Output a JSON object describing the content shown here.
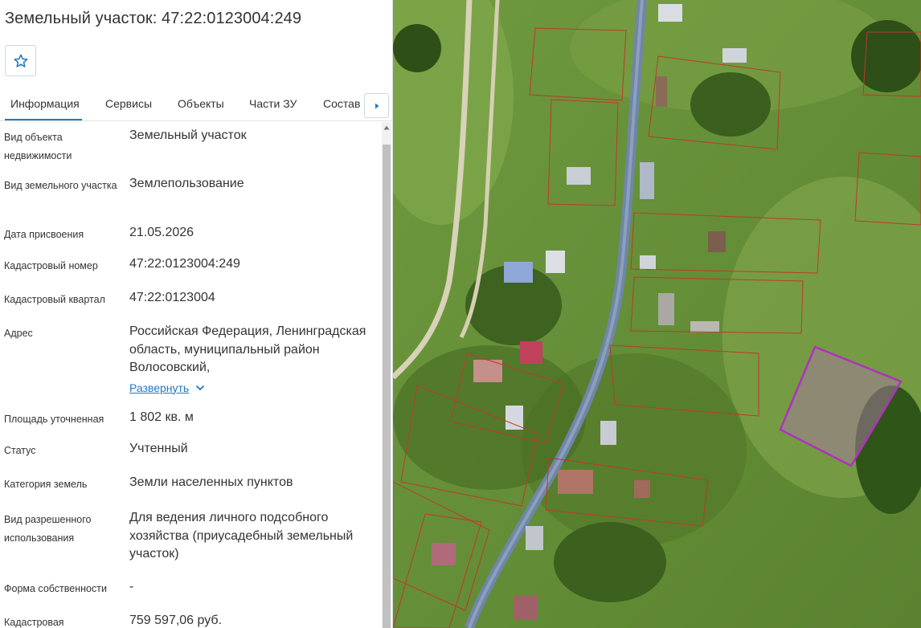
{
  "header": {
    "title": "Земельный участок: 47:22:0123004:249"
  },
  "tabs": [
    {
      "label": "Информация",
      "active": true
    },
    {
      "label": "Сервисы"
    },
    {
      "label": "Объекты"
    },
    {
      "label": "Части ЗУ"
    },
    {
      "label": "Состав"
    }
  ],
  "info": {
    "object_type": {
      "label": "Вид объекта недвижимости",
      "value": "Земельный участок"
    },
    "land_type": {
      "label": "Вид земельного участка",
      "value": "Землепользование"
    },
    "assign_date": {
      "label": "Дата присвоения",
      "value": "21.05.2026"
    },
    "cadastral_number": {
      "label": "Кадастровый номер",
      "value": "47:22:0123004:249"
    },
    "cadastral_quarter": {
      "label": "Кадастровый квартал",
      "value": "47:22:0123004"
    },
    "address": {
      "label": "Адрес",
      "value": "Российская Федерация, Ленинградская область, муниципальный район Волосовский,",
      "expand_label": "Развернуть"
    },
    "area": {
      "label": "Площадь уточненная",
      "value": "1 802 кв. м"
    },
    "status": {
      "label": "Статус",
      "value": "Учтенный"
    },
    "land_category": {
      "label": "Категория земель",
      "value": "Земли населенных пунктов"
    },
    "permitted_use": {
      "label": "Вид разрешенного использования",
      "value": "Для ведения личного подсобного хозяйства (приусадебный земельный участок)"
    },
    "ownership": {
      "label": "Форма собственности",
      "value": "-"
    },
    "cadastral_value": {
      "label": "Кадастровая",
      "value": "759 597,06 руб."
    }
  },
  "colors": {
    "accent": "#1f7ac1",
    "parcel_border": "#c0392b",
    "selected_parcel": "#b030c0"
  },
  "icons": {
    "favorite": "star-outline-icon",
    "tabs_next": "chevron-right-icon",
    "expand": "chevron-down-icon",
    "scroll_up": "triangle-up-icon"
  }
}
